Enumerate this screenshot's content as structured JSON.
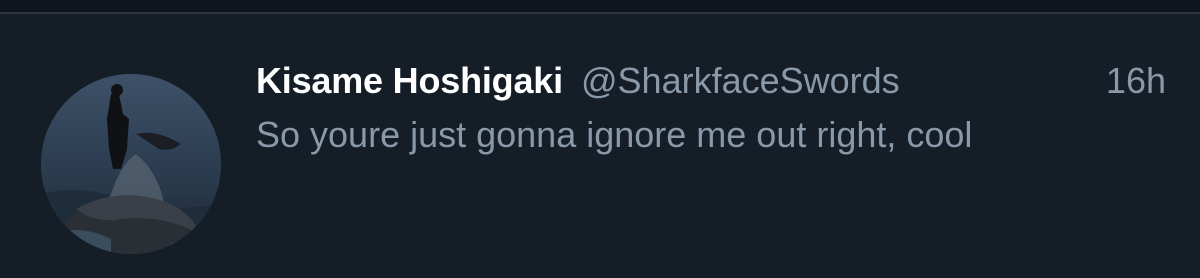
{
  "tweet": {
    "display_name": "Kisame Hoshigaki",
    "handle": "@SharkfaceSwords",
    "time_ago": "16h",
    "text": "So youre just gonna ignore me out right, cool"
  },
  "avatar": {
    "icon": "profile-avatar"
  },
  "colors": {
    "background": "#151d27",
    "name": "#ffffff",
    "secondary_text": "#8a99a8"
  }
}
